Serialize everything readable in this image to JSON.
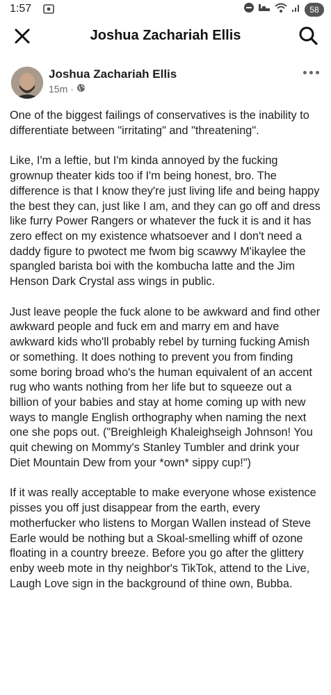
{
  "status_bar": {
    "time": "1:57",
    "battery": "58"
  },
  "header": {
    "title": "Joshua Zachariah Ellis"
  },
  "post": {
    "author": "Joshua Zachariah Ellis",
    "time_ago": "15m",
    "meta_separator": "·",
    "paragraphs": [
      "One of the biggest failings of conservatives is the inability to differentiate between \"irritating\" and \"threatening\".",
      "Like, I'm a leftie, but I'm kinda annoyed by the fucking grownup theater kids too if I'm being honest, bro. The difference is that I know they're just living life and being happy the best they can, just like I am, and they can go off and dress like furry Power Rangers or whatever the fuck it is and it has zero effect on my existence whatsoever and I don't need a daddy figure to pwotect me fwom big scawwy M'ikaylee the spangled barista boi with the kombucha latte and the Jim Henson Dark Crystal ass wings in public.",
      "Just leave people the fuck alone to be awkward and find other awkward people and fuck em and marry em and have awkward kids who'll probably rebel by turning fucking Amish or something. It does nothing to prevent you from finding some boring broad who's the human equivalent of an accent rug who wants nothing from her life but to squeeze out a billion of your babies and stay at home coming up with new ways to mangle English orthography when naming the next one she pops out. (\"Breighleigh Khaleighseigh Johnson! You quit chewing on Mommy's Stanley Tumbler and drink your Diet Mountain Dew from your *own* sippy cup!\")",
      "If it was really acceptable to make everyone whose existence pisses you off just disappear from the earth, every motherfucker who listens to Morgan Wallen instead of Steve Earle would be nothing but a Skoal-smelling whiff of ozone floating in a country breeze. Before you go after the glittery enby weeb mote in thy neighbor's TikTok, attend to the Live, Laugh Love sign in the background of thine own, Bubba."
    ]
  }
}
